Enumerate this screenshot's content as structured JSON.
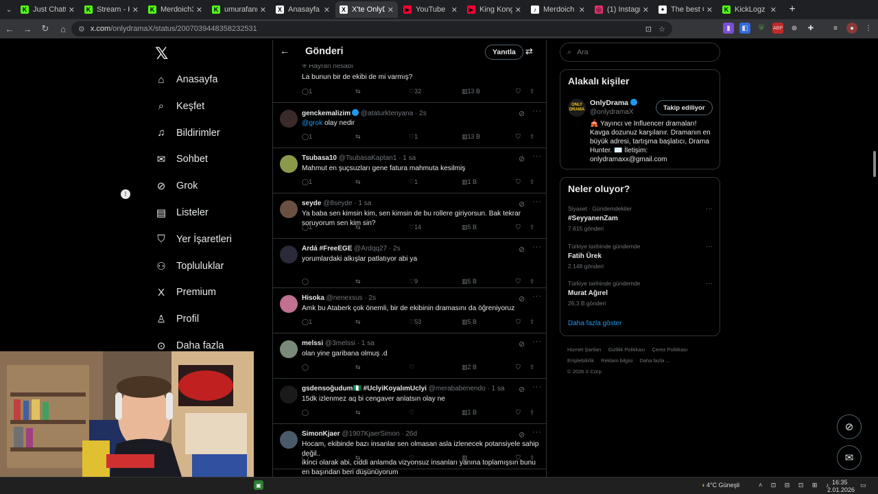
{
  "browser": {
    "tabs": [
      {
        "title": "Just Chatting",
        "fav_color": "#53fc18",
        "fav_letter": "K"
      },
      {
        "title": "Stream - Kick",
        "fav_color": "#53fc18",
        "fav_letter": "K"
      },
      {
        "title": "Merdoich34",
        "fav_color": "#53fc18",
        "fav_letter": "K"
      },
      {
        "title": "umurafann",
        "fav_color": "#53fc18",
        "fav_letter": "K"
      },
      {
        "title": "Anasayfa / X",
        "fav_color": "#ffffff",
        "fav_letter": "X"
      },
      {
        "title": "X'te OnlyDrama",
        "fav_color": "#ffffff",
        "fav_letter": "X",
        "active": true
      },
      {
        "title": "YouTube",
        "fav_color": "#ff0033",
        "fav_letter": "▶"
      },
      {
        "title": "King Kong -",
        "fav_color": "#ff0033",
        "fav_letter": "▶"
      },
      {
        "title": "Merdoich (@",
        "fav_color": "#ffffff",
        "fav_letter": "♪"
      },
      {
        "title": "(1) Instagram",
        "fav_color": "#e1306c",
        "fav_letter": "◎"
      },
      {
        "title": "The best Ch",
        "fav_color": "#ffffff",
        "fav_letter": "✦"
      },
      {
        "title": "KickLogz - K",
        "fav_color": "#53fc18",
        "fav_letter": "K"
      }
    ],
    "url_host": "x.com",
    "url_path": "/onlydramaX/status/2007039448358232531"
  },
  "nav": {
    "items": [
      {
        "label": "Anasayfa",
        "icon": "home-icon",
        "glyph": "⌂"
      },
      {
        "label": "Keşfet",
        "icon": "search-icon",
        "glyph": "⌕"
      },
      {
        "label": "Bildirimler",
        "icon": "bell-icon",
        "glyph": "♫"
      },
      {
        "label": "Sohbet",
        "icon": "mail-icon",
        "glyph": "✉"
      },
      {
        "label": "Grok",
        "icon": "grok-icon",
        "glyph": "⊘"
      },
      {
        "label": "Listeler",
        "icon": "list-icon",
        "glyph": "▤"
      },
      {
        "label": "Yer İşaretleri",
        "icon": "bookmark-icon",
        "glyph": "⛉"
      },
      {
        "label": "Topluluklar",
        "icon": "communities-icon",
        "glyph": "⚇"
      },
      {
        "label": "Premium",
        "icon": "x-logo-icon",
        "glyph": "X"
      },
      {
        "label": "Profil",
        "icon": "profile-icon",
        "glyph": "♙"
      },
      {
        "label": "Daha fazla",
        "icon": "more-circle-icon",
        "glyph": "⊙"
      }
    ]
  },
  "main": {
    "title": "Gönderi",
    "reply_label": "Yanıtla",
    "top_post": {
      "badge": "Hayran hesabı",
      "text": "La bunun bir de ekibi de mi varmış?",
      "replies": "1",
      "likes": "32",
      "views": "13 B"
    },
    "posts": [
      {
        "name": "genckemalizim",
        "verified": true,
        "handle": "@ataturktenyana",
        "time": "· 2s",
        "mention": "@grok",
        "text": " olay nedir",
        "replies": "1",
        "likes": "1",
        "views": "13 B",
        "avatar": "#3a2a2a"
      },
      {
        "name": "Tsubasa10",
        "verified": false,
        "handle": "@TsubasaKaptan1",
        "time": "· 1 sa",
        "text": "Mahmut en şuçsuzları gene fatura mahmuta kesilmiş",
        "replies": "1",
        "likes": "1",
        "views": "1 B",
        "avatar": "#8a9a4a"
      },
      {
        "name": "seyde",
        "verified": false,
        "handle": "@8seyde",
        "time": "· 1 sa",
        "text": "Ya baba sen kimsin kim, sen kimsin de bu rollere giriyorsun. Bak tekrar soruyorum sen kim sin?",
        "replies": "1",
        "likes": "14",
        "views": "5 B",
        "avatar": "#6a5040"
      },
      {
        "name": "Ardá #FreeEGE",
        "verified": false,
        "handle": "@Ardqq27",
        "time": "· 2s",
        "text": "yorumlardaki alkışlar patlatıyor abi ya",
        "replies": "",
        "likes": "9",
        "views": "5 B",
        "avatar": "#2a2a3a"
      },
      {
        "name": "Hisoka",
        "verified": false,
        "handle": "@nenexsus",
        "time": "· 2s",
        "text": "Amk bu Ataberk çok önemli, bir de ekibinin dramasını da öğreniyoruz",
        "replies": "1",
        "likes": "53",
        "views": "5 B",
        "avatar": "#c07090"
      },
      {
        "name": "melssi",
        "verified": false,
        "handle": "@3melssi",
        "time": "· 1 sa",
        "text": "olan yine garibana olmuş .d",
        "replies": "",
        "likes": "",
        "views": "2 B",
        "avatar": "#7a8a7a"
      },
      {
        "name": "gsdensoğudum🇳🇬 #UclyiKoyalımUclyi",
        "verified": false,
        "handle": "@merababenendo",
        "time": "· 1 sa",
        "text": "15dk izlenmez aq bi cengaver anlatsın olay ne",
        "replies": "",
        "likes": "",
        "views": "1 B",
        "avatar": "#1a1a1a"
      },
      {
        "name": "SimonKjaer",
        "verified": false,
        "handle": "@1907KjaerSimon",
        "time": "· 26d",
        "text": "Hocam, ekibinde bazı insanlar sen olmasan asla izlenecek potansiyele sahip değil..\nikinci olarak abi, ciddi anlamda vizyonsuz insanları yanına toplamışsın bunu en başından beri düşünüyorum",
        "replies": "",
        "likes": "",
        "views": "",
        "avatar": "#4a5a6a"
      }
    ]
  },
  "right": {
    "search_placeholder": "Ara",
    "related_title": "Alakalı kişiler",
    "person": {
      "name": "OnlyDrama",
      "handle": "@onlydramaX",
      "avatar_text": "ONLY DRAMA",
      "follow_label": "Takip ediliyor",
      "bio": "🎪 Yayıncı ve Influencer dramaları! Kavga dozunuz karşılanır. Dramanın en büyük adresi, tartışma başlatıcı, Drama Hunter. ✉️ İletişim: onlydramaxx@gmail.com"
    },
    "trends_title": "Neler oluyor?",
    "trends": [
      {
        "category": "Siyaset · Gündemdekiler",
        "name": "#SeyyanenZam",
        "count": "7.615 gönderi"
      },
      {
        "category": "Türkiye tarihinde gündemde",
        "name": "Fatih Ürek",
        "count": "2.148 gönderi"
      },
      {
        "category": "Türkiye tarihinde gündemde",
        "name": "Murat Ağırel",
        "count": "26,3 B gönderi"
      }
    ],
    "show_more": "Daha fazla göster",
    "footer": [
      "Hizmet Şartları",
      "Gizlilik Politikası",
      "Çerez Politikası",
      "Erişilebilirlik",
      "Reklam bilgisi",
      "Daha fazla ...",
      "© 2026 X Corp."
    ]
  },
  "taskbar": {
    "weather": "4°C  Güneşli",
    "time": "16:35",
    "date": "2.01.2026"
  }
}
